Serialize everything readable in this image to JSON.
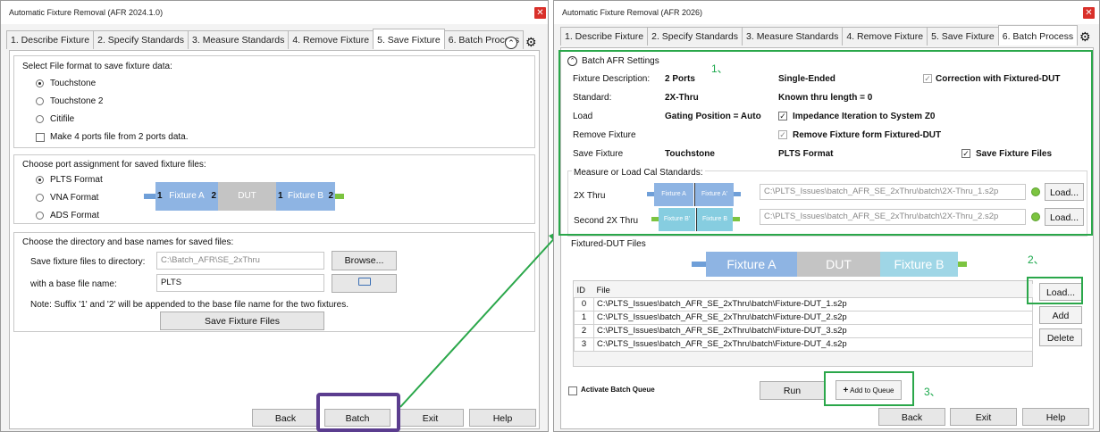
{
  "left": {
    "title": "Automatic Fixture Removal (AFR 2024.1.0)",
    "tabs": [
      "1. Describe Fixture",
      "2. Specify Standards",
      "3. Measure Standards",
      "4. Remove Fixture",
      "5. Save Fixture",
      "6. Batch Process"
    ],
    "format_group": {
      "label": "Select File format to save fixture data:",
      "options": [
        "Touchstone",
        "Touchstone 2",
        "Citifile"
      ],
      "selected": "Touchstone",
      "make4_label": "Make 4 ports file from 2 ports data."
    },
    "port_group": {
      "label": "Choose port assignment for saved fixture files:",
      "options": [
        "PLTS Format",
        "VNA Format",
        "ADS Format"
      ],
      "selected": "PLTS Format",
      "diagram": {
        "port1": "1",
        "fixA": "Fixture A",
        "port2": "2",
        "dut": "DUT",
        "port1b": "1",
        "fixB": "Fixture B",
        "port2b": "2"
      }
    },
    "dir_group": {
      "label": "Choose the directory and base names for saved files:",
      "dir_label": "Save fixture files to directory:",
      "dir_value": "C:\\Batch_AFR\\SE_2xThru",
      "browse": "Browse...",
      "base_label": "with a base file name:",
      "base_value": "PLTS",
      "note": "Note: Suffix '1' and '2' will be appended to the base file name for the two fixtures.",
      "save_btn": "Save Fixture Files"
    },
    "footer": {
      "back": "Back",
      "batch": "Batch",
      "exit": "Exit",
      "help": "Help"
    }
  },
  "right": {
    "title": "Automatic Fixture Removal (AFR 2026)",
    "tabs": [
      "1. Describe Fixture",
      "2. Specify Standards",
      "3. Measure Standards",
      "4. Remove Fixture",
      "5. Save Fixture",
      "6. Batch Process"
    ],
    "batch_settings": {
      "header": "Batch AFR Settings",
      "rows": [
        {
          "label": "Fixture Description:",
          "v1": "2 Ports",
          "v2": "Single-Ended",
          "v3": "Correction with Fixtured-DUT"
        },
        {
          "label": "Standard:",
          "v1": "2X-Thru",
          "v2": "Known thru length = 0"
        },
        {
          "label": "Load",
          "v1": "Gating Position = Auto",
          "v2": "Impedance Iteration to System Z0"
        },
        {
          "label": "Remove Fixture",
          "v2": "Remove Fixture form Fixtured-DUT"
        },
        {
          "label": "Save Fixture",
          "v1": "Touchstone",
          "v2": "PLTS Format",
          "v3": "Save Fixture Files"
        }
      ]
    },
    "cal": {
      "label": "Measure or Load Cal Standards:",
      "rows": [
        {
          "label": "2X Thru",
          "blkA": "Fixture A",
          "blkB": "Fixture A'",
          "path": "C:\\PLTS_Issues\\batch_AFR_SE_2xThru\\batch\\2X-Thru_1.s2p",
          "load": "Load..."
        },
        {
          "label": "Second 2X Thru",
          "blkA": "Fixture B'",
          "blkB": "Fixture B",
          "path": "C:\\PLTS_Issues\\batch_AFR_SE_2xThru\\batch\\2X-Thru_2.s2p",
          "load": "Load..."
        }
      ]
    },
    "dut_files": {
      "label": "Fixtured-DUT Files",
      "diag": {
        "a": "Fixture A",
        "dut": "DUT",
        "b": "Fixture B"
      },
      "headers": [
        "ID",
        "File"
      ],
      "rows": [
        {
          "id": "0",
          "file": "C:\\PLTS_Issues\\batch_AFR_SE_2xThru\\batch\\Fixture-DUT_1.s2p"
        },
        {
          "id": "1",
          "file": "C:\\PLTS_Issues\\batch_AFR_SE_2xThru\\batch\\Fixture-DUT_2.s2p"
        },
        {
          "id": "2",
          "file": "C:\\PLTS_Issues\\batch_AFR_SE_2xThru\\batch\\Fixture-DUT_3.s2p"
        },
        {
          "id": "3",
          "file": "C:\\PLTS_Issues\\batch_AFR_SE_2xThru\\batch\\Fixture-DUT_4.s2p"
        }
      ],
      "load": "Load...",
      "add": "Add",
      "delete": "Delete"
    },
    "queue": {
      "activate": "Activate Batch Queue",
      "run": "Run",
      "add_queue": "Add to Queue"
    },
    "footer": {
      "back": "Back",
      "exit": "Exit",
      "help": "Help"
    }
  },
  "annotations": {
    "a1": "1、",
    "a2": "2、",
    "a3": "3、"
  },
  "colors": {
    "fixA": "#6f9fd8",
    "fixB": "#86cde0",
    "dut": "#c0c0c0",
    "green": "#2aa74a",
    "purple": "#5b3d8f",
    "port": "#7cc440"
  }
}
